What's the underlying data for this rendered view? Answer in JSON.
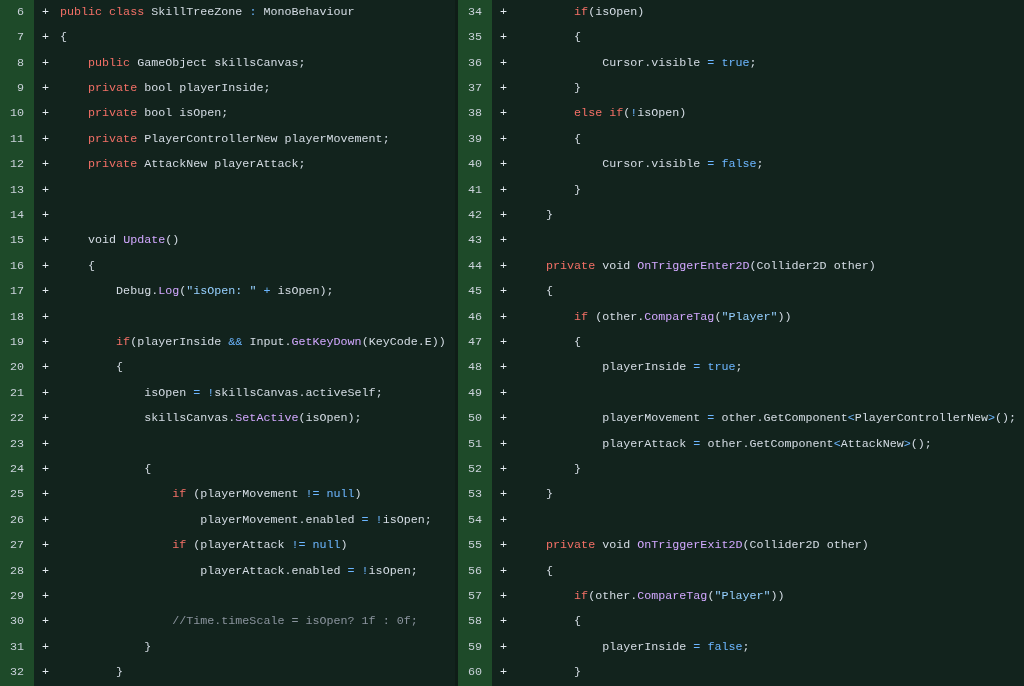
{
  "panels": [
    {
      "lines": [
        {
          "number": "6",
          "sign": "+",
          "tokens": [
            {
              "text": "public class",
              "kind": "keyword"
            },
            {
              "text": " SkillTreeZone ",
              "kind": "plain"
            },
            {
              "text": ":",
              "kind": "operator"
            },
            {
              "text": " MonoBehaviour",
              "kind": "plain"
            }
          ]
        },
        {
          "number": "7",
          "sign": "+",
          "tokens": [
            {
              "text": "{",
              "kind": "plain"
            }
          ]
        },
        {
          "number": "8",
          "sign": "+",
          "tokens": [
            {
              "text": "    public",
              "kind": "keyword"
            },
            {
              "text": " GameObject skillsCanvas;",
              "kind": "plain"
            }
          ]
        },
        {
          "number": "9",
          "sign": "+",
          "tokens": [
            {
              "text": "    private",
              "kind": "keyword"
            },
            {
              "text": " bool playerInside;",
              "kind": "plain"
            }
          ]
        },
        {
          "number": "10",
          "sign": "+",
          "tokens": [
            {
              "text": "    private",
              "kind": "keyword"
            },
            {
              "text": " bool isOpen;",
              "kind": "plain"
            }
          ]
        },
        {
          "number": "11",
          "sign": "+",
          "tokens": [
            {
              "text": "    private",
              "kind": "keyword"
            },
            {
              "text": " PlayerControllerNew playerMovement;",
              "kind": "plain"
            }
          ]
        },
        {
          "number": "12",
          "sign": "+",
          "tokens": [
            {
              "text": "    private",
              "kind": "keyword"
            },
            {
              "text": " AttackNew playerAttack;",
              "kind": "plain"
            }
          ]
        },
        {
          "number": "13",
          "sign": "+"
        },
        {
          "number": "14",
          "sign": "+"
        },
        {
          "number": "15",
          "sign": "+",
          "tokens": [
            {
              "text": "    void ",
              "kind": "plain"
            },
            {
              "text": "Update",
              "kind": "method"
            },
            {
              "text": "()",
              "kind": "plain"
            }
          ]
        },
        {
          "number": "16",
          "sign": "+",
          "tokens": [
            {
              "text": "    {",
              "kind": "plain"
            }
          ]
        },
        {
          "number": "17",
          "sign": "+",
          "tokens": [
            {
              "text": "        Debug.",
              "kind": "plain"
            },
            {
              "text": "Log",
              "kind": "method"
            },
            {
              "text": "(",
              "kind": "plain"
            },
            {
              "text": "\"isOpen: \"",
              "kind": "string"
            },
            {
              "text": " + ",
              "kind": "operator"
            },
            {
              "text": "isOpen);",
              "kind": "plain"
            }
          ]
        },
        {
          "number": "18",
          "sign": "+"
        },
        {
          "number": "19",
          "sign": "+",
          "tokens": [
            {
              "text": "        if",
              "kind": "keyword"
            },
            {
              "text": "(playerInside",
              "kind": "plain"
            },
            {
              "text": " && ",
              "kind": "operator"
            },
            {
              "text": "Input.",
              "kind": "plain"
            },
            {
              "text": "GetKeyDown",
              "kind": "method"
            },
            {
              "text": "(KeyCode.E))",
              "kind": "plain"
            }
          ]
        },
        {
          "number": "20",
          "sign": "+",
          "tokens": [
            {
              "text": "        {",
              "kind": "plain"
            }
          ]
        },
        {
          "number": "21",
          "sign": "+",
          "tokens": [
            {
              "text": "            isOpen",
              "kind": "plain"
            },
            {
              "text": " = !",
              "kind": "operator"
            },
            {
              "text": "skillsCanvas.activeSelf;",
              "kind": "plain"
            }
          ]
        },
        {
          "number": "22",
          "sign": "+",
          "tokens": [
            {
              "text": "            skillsCanvas.",
              "kind": "plain"
            },
            {
              "text": "SetActive",
              "kind": "method"
            },
            {
              "text": "(isOpen);",
              "kind": "plain"
            }
          ]
        },
        {
          "number": "23",
          "sign": "+"
        },
        {
          "number": "24",
          "sign": "+",
          "tokens": [
            {
              "text": "            {",
              "kind": "plain"
            }
          ]
        },
        {
          "number": "25",
          "sign": "+",
          "tokens": [
            {
              "text": "                if",
              "kind": "keyword"
            },
            {
              "text": " (playerMovement",
              "kind": "plain"
            },
            {
              "text": " != ",
              "kind": "operator"
            },
            {
              "text": "null",
              "kind": "constant"
            },
            {
              "text": ")",
              "kind": "plain"
            }
          ]
        },
        {
          "number": "26",
          "sign": "+",
          "tokens": [
            {
              "text": "                    playerMovement.enabled",
              "kind": "plain"
            },
            {
              "text": " = !",
              "kind": "operator"
            },
            {
              "text": "isOpen;",
              "kind": "plain"
            }
          ]
        },
        {
          "number": "27",
          "sign": "+",
          "tokens": [
            {
              "text": "                if",
              "kind": "keyword"
            },
            {
              "text": " (playerAttack",
              "kind": "plain"
            },
            {
              "text": " != ",
              "kind": "operator"
            },
            {
              "text": "null",
              "kind": "constant"
            },
            {
              "text": ")",
              "kind": "plain"
            }
          ]
        },
        {
          "number": "28",
          "sign": "+",
          "tokens": [
            {
              "text": "                    playerAttack.enabled",
              "kind": "plain"
            },
            {
              "text": " = !",
              "kind": "operator"
            },
            {
              "text": "isOpen;",
              "kind": "plain"
            }
          ]
        },
        {
          "number": "29",
          "sign": "+"
        },
        {
          "number": "30",
          "sign": "+",
          "tokens": [
            {
              "text": "                //Time.timeScale = isOpen? 1f : 0f;",
              "kind": "comment"
            }
          ]
        },
        {
          "number": "31",
          "sign": "+",
          "tokens": [
            {
              "text": "            }",
              "kind": "plain"
            }
          ]
        },
        {
          "number": "32",
          "sign": "+",
          "tokens": [
            {
              "text": "        }",
              "kind": "plain"
            }
          ]
        }
      ]
    },
    {
      "lines": [
        {
          "number": "34",
          "sign": "+",
          "tokens": [
            {
              "text": "        if",
              "kind": "keyword"
            },
            {
              "text": "(isOpen)",
              "kind": "plain"
            }
          ]
        },
        {
          "number": "35",
          "sign": "+",
          "tokens": [
            {
              "text": "        {",
              "kind": "plain"
            }
          ]
        },
        {
          "number": "36",
          "sign": "+",
          "tokens": [
            {
              "text": "            Cursor.visible",
              "kind": "plain"
            },
            {
              "text": " = ",
              "kind": "operator"
            },
            {
              "text": "true",
              "kind": "constant"
            },
            {
              "text": ";",
              "kind": "plain"
            }
          ]
        },
        {
          "number": "37",
          "sign": "+",
          "tokens": [
            {
              "text": "        }",
              "kind": "plain"
            }
          ]
        },
        {
          "number": "38",
          "sign": "+",
          "tokens": [
            {
              "text": "        else if",
              "kind": "keyword"
            },
            {
              "text": "(",
              "kind": "plain"
            },
            {
              "text": "!",
              "kind": "operator"
            },
            {
              "text": "isOpen)",
              "kind": "plain"
            }
          ]
        },
        {
          "number": "39",
          "sign": "+",
          "tokens": [
            {
              "text": "        {",
              "kind": "plain"
            }
          ]
        },
        {
          "number": "40",
          "sign": "+",
          "tokens": [
            {
              "text": "            Cursor.visible",
              "kind": "plain"
            },
            {
              "text": " = ",
              "kind": "operator"
            },
            {
              "text": "false",
              "kind": "constant"
            },
            {
              "text": ";",
              "kind": "plain"
            }
          ]
        },
        {
          "number": "41",
          "sign": "+",
          "tokens": [
            {
              "text": "        }",
              "kind": "plain"
            }
          ]
        },
        {
          "number": "42",
          "sign": "+",
          "tokens": [
            {
              "text": "    }",
              "kind": "plain"
            }
          ]
        },
        {
          "number": "43",
          "sign": "+"
        },
        {
          "number": "44",
          "sign": "+",
          "tokens": [
            {
              "text": "    private",
              "kind": "keyword"
            },
            {
              "text": " void ",
              "kind": "plain"
            },
            {
              "text": "OnTriggerEnter2D",
              "kind": "method"
            },
            {
              "text": "(Collider2D other)",
              "kind": "plain"
            }
          ]
        },
        {
          "number": "45",
          "sign": "+",
          "tokens": [
            {
              "text": "    {",
              "kind": "plain"
            }
          ]
        },
        {
          "number": "46",
          "sign": "+",
          "tokens": [
            {
              "text": "        if",
              "kind": "keyword"
            },
            {
              "text": " (other.",
              "kind": "plain"
            },
            {
              "text": "CompareTag",
              "kind": "method"
            },
            {
              "text": "(",
              "kind": "plain"
            },
            {
              "text": "\"Player\"",
              "kind": "string"
            },
            {
              "text": "))",
              "kind": "plain"
            }
          ]
        },
        {
          "number": "47",
          "sign": "+",
          "tokens": [
            {
              "text": "        {",
              "kind": "plain"
            }
          ]
        },
        {
          "number": "48",
          "sign": "+",
          "tokens": [
            {
              "text": "            playerInside",
              "kind": "plain"
            },
            {
              "text": " = ",
              "kind": "operator"
            },
            {
              "text": "true",
              "kind": "constant"
            },
            {
              "text": ";",
              "kind": "plain"
            }
          ]
        },
        {
          "number": "49",
          "sign": "+"
        },
        {
          "number": "50",
          "sign": "+",
          "tokens": [
            {
              "text": "            playerMovement",
              "kind": "plain"
            },
            {
              "text": " = ",
              "kind": "operator"
            },
            {
              "text": "other.GetComponent",
              "kind": "plain"
            },
            {
              "text": "<",
              "kind": "operator"
            },
            {
              "text": "PlayerControllerNew",
              "kind": "plain"
            },
            {
              "text": ">",
              "kind": "operator"
            },
            {
              "text": "();",
              "kind": "plain"
            }
          ]
        },
        {
          "number": "51",
          "sign": "+",
          "tokens": [
            {
              "text": "            playerAttack",
              "kind": "plain"
            },
            {
              "text": " = ",
              "kind": "operator"
            },
            {
              "text": "other.GetComponent",
              "kind": "plain"
            },
            {
              "text": "<",
              "kind": "operator"
            },
            {
              "text": "AttackNew",
              "kind": "plain"
            },
            {
              "text": ">",
              "kind": "operator"
            },
            {
              "text": "();",
              "kind": "plain"
            }
          ]
        },
        {
          "number": "52",
          "sign": "+",
          "tokens": [
            {
              "text": "        }",
              "kind": "plain"
            }
          ]
        },
        {
          "number": "53",
          "sign": "+",
          "tokens": [
            {
              "text": "    }",
              "kind": "plain"
            }
          ]
        },
        {
          "number": "54",
          "sign": "+"
        },
        {
          "number": "55",
          "sign": "+",
          "tokens": [
            {
              "text": "    private",
              "kind": "keyword"
            },
            {
              "text": " void ",
              "kind": "plain"
            },
            {
              "text": "OnTriggerExit2D",
              "kind": "method"
            },
            {
              "text": "(Collider2D other)",
              "kind": "plain"
            }
          ]
        },
        {
          "number": "56",
          "sign": "+",
          "tokens": [
            {
              "text": "    {",
              "kind": "plain"
            }
          ]
        },
        {
          "number": "57",
          "sign": "+",
          "tokens": [
            {
              "text": "        if",
              "kind": "keyword"
            },
            {
              "text": "(other.",
              "kind": "plain"
            },
            {
              "text": "CompareTag",
              "kind": "method"
            },
            {
              "text": "(",
              "kind": "plain"
            },
            {
              "text": "\"Player\"",
              "kind": "string"
            },
            {
              "text": "))",
              "kind": "plain"
            }
          ]
        },
        {
          "number": "58",
          "sign": "+",
          "tokens": [
            {
              "text": "        {",
              "kind": "plain"
            }
          ]
        },
        {
          "number": "59",
          "sign": "+",
          "tokens": [
            {
              "text": "            playerInside",
              "kind": "plain"
            },
            {
              "text": " = ",
              "kind": "operator"
            },
            {
              "text": "false",
              "kind": "constant"
            },
            {
              "text": ";",
              "kind": "plain"
            }
          ]
        },
        {
          "number": "60",
          "sign": "+",
          "tokens": [
            {
              "text": "        }",
              "kind": "plain"
            }
          ]
        }
      ]
    }
  ]
}
